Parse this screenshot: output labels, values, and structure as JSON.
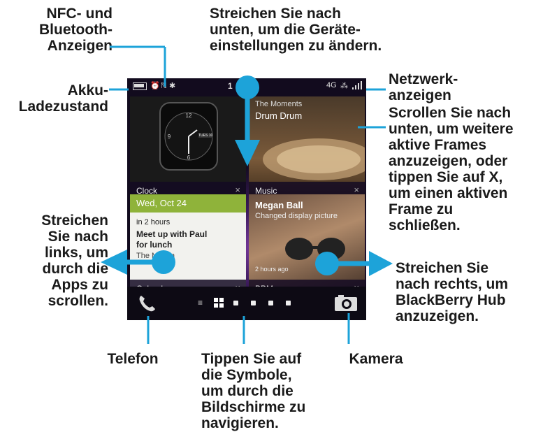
{
  "callouts": {
    "nfc_bluetooth": "NFC- und\nBluetooth-\nAnzeigen",
    "swipe_down": "Streichen Sie nach\nunten, um die Geräte-\neinstellungen zu ändern.",
    "battery": "Akku-\nLadezustand",
    "network": "Netzwerk-\nanzeigen",
    "scroll_frames": "Scrollen Sie nach\nunten, um weitere\naktive Frames\nanzuzeigen, oder\ntippen Sie auf X,\num einen aktiven\nFrame zu\nschließen.",
    "swipe_left": "Streichen\nSie nach\nlinks, um\ndurch die\nApps zu\nscrollen.",
    "swipe_right": "Streichen Sie\nnach rechts, um\nBlackBerry Hub\nanzuzeigen.",
    "phone": "Telefon",
    "icons": "Tippen Sie auf\ndie Symbole,\num durch die\nBildschirme zu\nnavigieren.",
    "camera": "Kamera"
  },
  "status_bar": {
    "time_partial": "1",
    "network": "4G"
  },
  "tiles": {
    "clock": {
      "label": "Clock",
      "close": "×",
      "date_badge": "TUES 10"
    },
    "music": {
      "label": "Music",
      "close": "×",
      "artist": "The Moments",
      "title": "Drum Drum"
    },
    "calendar": {
      "label": "Calendar",
      "close": "×",
      "date": "Wed, Oct 24",
      "when": "in 2 hours",
      "event": "Meet up with Paul for lunch",
      "location": "The Motion"
    },
    "bbm": {
      "label": "BBM",
      "close": "×",
      "name": "Megan Ball",
      "status": "Changed display picture",
      "time": "2 hours ago"
    }
  },
  "colors": {
    "accent": "#1da3d9",
    "calendar_header": "#8fb33a"
  }
}
